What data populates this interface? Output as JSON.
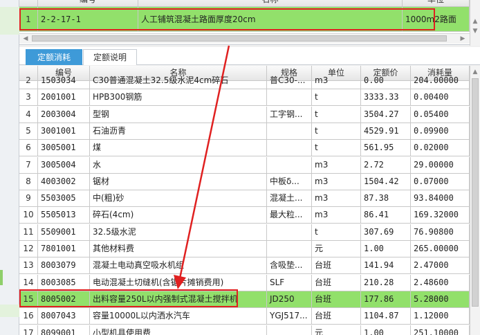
{
  "top_grid": {
    "headers": [
      "编号",
      "名称",
      "单位"
    ],
    "row": {
      "index": "1",
      "code": "2-2-17-1",
      "name": "人工铺筑混凝土路面厚度20cm",
      "unit": "1000m2路面"
    }
  },
  "tabs": [
    {
      "label": "定额消耗",
      "active": true
    },
    {
      "label": "定额说明",
      "active": false
    }
  ],
  "bottom_grid": {
    "headers": [
      "编号",
      "名称",
      "规格",
      "单位",
      "定额价",
      "消耗量"
    ],
    "rows": [
      {
        "index": "2",
        "code": "1503034",
        "name": "C30普通混凝土32.5级水泥4cm碎石",
        "spec": "普C30-...",
        "unit": "m3",
        "price": "0.00",
        "qty": "204.00000"
      },
      {
        "index": "3",
        "code": "2001001",
        "name": "HPB300钢筋",
        "spec": "",
        "unit": "t",
        "price": "3333.33",
        "qty": "0.00400"
      },
      {
        "index": "4",
        "code": "2003004",
        "name": "型钢",
        "spec": "工字钢...",
        "unit": "t",
        "price": "3504.27",
        "qty": "0.05400"
      },
      {
        "index": "5",
        "code": "3001001",
        "name": "石油沥青",
        "spec": "",
        "unit": "t",
        "price": "4529.91",
        "qty": "0.09900"
      },
      {
        "index": "6",
        "code": "3005001",
        "name": "煤",
        "spec": "",
        "unit": "t",
        "price": "561.95",
        "qty": "0.02000"
      },
      {
        "index": "7",
        "code": "3005004",
        "name": "水",
        "spec": "",
        "unit": "m3",
        "price": "2.72",
        "qty": "29.00000"
      },
      {
        "index": "8",
        "code": "4003002",
        "name": "锯材",
        "spec": "中板δ...",
        "unit": "m3",
        "price": "1504.42",
        "qty": "0.07000"
      },
      {
        "index": "9",
        "code": "5503005",
        "name": "中(粗)砂",
        "spec": "混凝土...",
        "unit": "m3",
        "price": "87.38",
        "qty": "93.84000"
      },
      {
        "index": "10",
        "code": "5505013",
        "name": "碎石(4cm)",
        "spec": "最大粒...",
        "unit": "m3",
        "price": "86.41",
        "qty": "169.32000"
      },
      {
        "index": "11",
        "code": "5509001",
        "name": "32.5级水泥",
        "spec": "",
        "unit": "t",
        "price": "307.69",
        "qty": "76.90800"
      },
      {
        "index": "12",
        "code": "7801001",
        "name": "其他材料费",
        "spec": "",
        "unit": "元",
        "price": "1.00",
        "qty": "265.00000"
      },
      {
        "index": "13",
        "code": "8003079",
        "name": "混凝土电动真空吸水机组",
        "spec": "含吸垫...",
        "unit": "台班",
        "price": "141.94",
        "qty": "2.47000"
      },
      {
        "index": "14",
        "code": "8003085",
        "name": "电动混凝土切缝机(含锯片摊销费用)",
        "spec": "SLF",
        "unit": "台班",
        "price": "210.28",
        "qty": "2.48600"
      },
      {
        "index": "15",
        "code": "8005002",
        "name": "出料容量250L以内强制式混凝土搅拌机",
        "spec": "JD250",
        "unit": "台班",
        "price": "177.86",
        "qty": "5.28000",
        "selected": true
      },
      {
        "index": "16",
        "code": "8007043",
        "name": "容量10000L以内洒水汽车",
        "spec": "YGJ517...",
        "unit": "台班",
        "price": "1104.87",
        "qty": "1.12000"
      },
      {
        "index": "17",
        "code": "8099001",
        "name": "小型机具使用费",
        "spec": "",
        "unit": "元",
        "price": "1.00",
        "qty": "251.10000"
      }
    ]
  },
  "colors": {
    "selected_row": "#92e06b",
    "tab_active": "#3e9ad8",
    "annotation": "#e02020"
  }
}
